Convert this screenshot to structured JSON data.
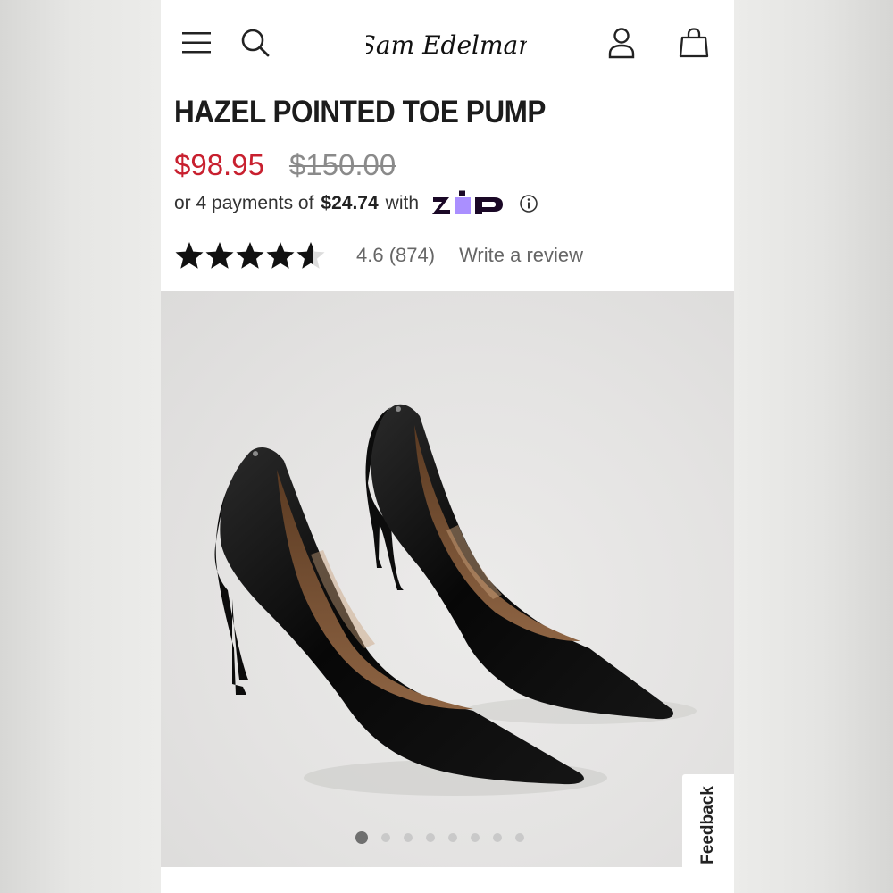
{
  "header": {
    "logo_text": "Sam Edelman",
    "icons": [
      "menu-icon",
      "search-icon",
      "account-icon",
      "bag-icon"
    ]
  },
  "product": {
    "title": "HAZEL POINTED TOE PUMP",
    "sale_price": "$98.95",
    "original_price": "$150.00"
  },
  "payments": {
    "prefix": "or 4 payments of",
    "amount": "$24.74",
    "suffix": "with",
    "provider": "zip"
  },
  "rating": {
    "stars": 4.6,
    "text": "4.6 (874)",
    "write_review": "Write a review"
  },
  "gallery": {
    "image_count": 8,
    "active_index": 0
  },
  "feedback": {
    "label": "Feedback"
  },
  "colors": {
    "sale_red": "#c8202f",
    "zip_purple": "#aa8fff",
    "zip_navy": "#1a0826"
  }
}
